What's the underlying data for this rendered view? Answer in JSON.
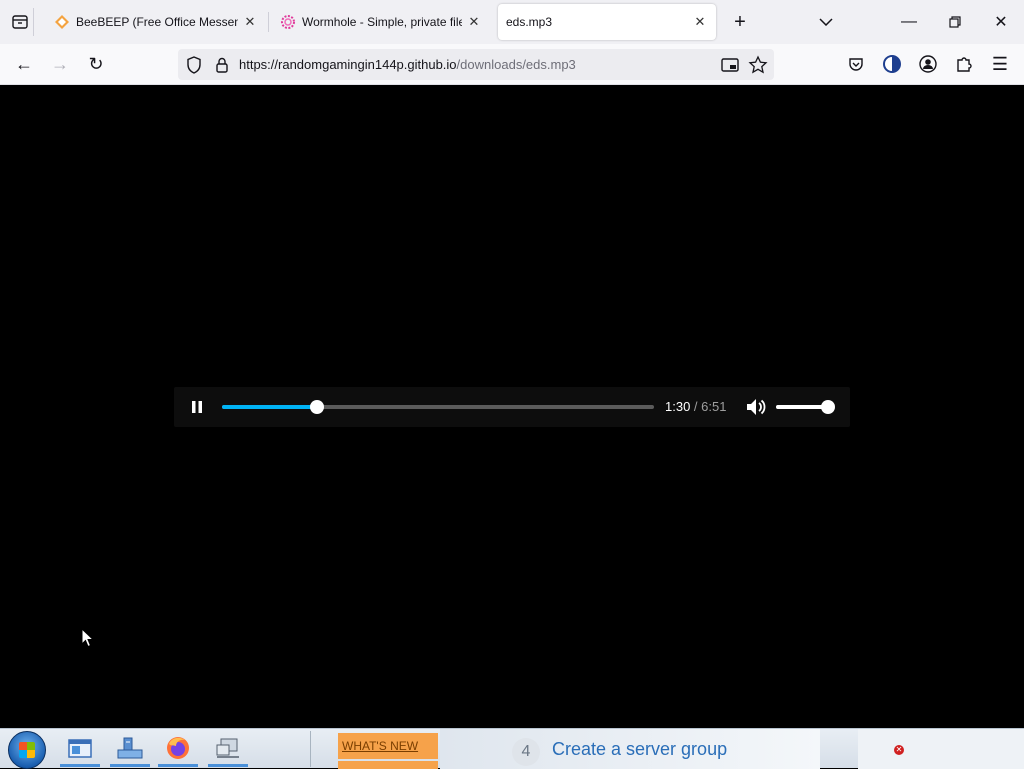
{
  "tabs": [
    {
      "title": "BeeBEEP (Free Office Messenger)",
      "active": false,
      "favicon": "beebeep-icon"
    },
    {
      "title": "Wormhole - Simple, private file sharing",
      "active": false,
      "favicon": "wormhole-icon"
    },
    {
      "title": "eds.mp3",
      "active": true,
      "favicon": "none"
    }
  ],
  "urlbar": {
    "url_host": "https://randomgamingin144p.github.io",
    "url_path": "/downloads/eds.mp3"
  },
  "player": {
    "state": "playing",
    "current_time": "1:30",
    "separator": " / ",
    "total_time": "6:51",
    "progress_fraction": 0.219,
    "volume_fraction": 1.0,
    "accent_color": "#00b3f4"
  },
  "taskbar": {
    "whats_new_label": "WHAT'S NEW",
    "server_step_number": "4",
    "server_step_label": "Create a server group",
    "apps": [
      "explorer-window-icon",
      "server-manager-icon",
      "firefox-icon",
      "network-icon"
    ]
  }
}
